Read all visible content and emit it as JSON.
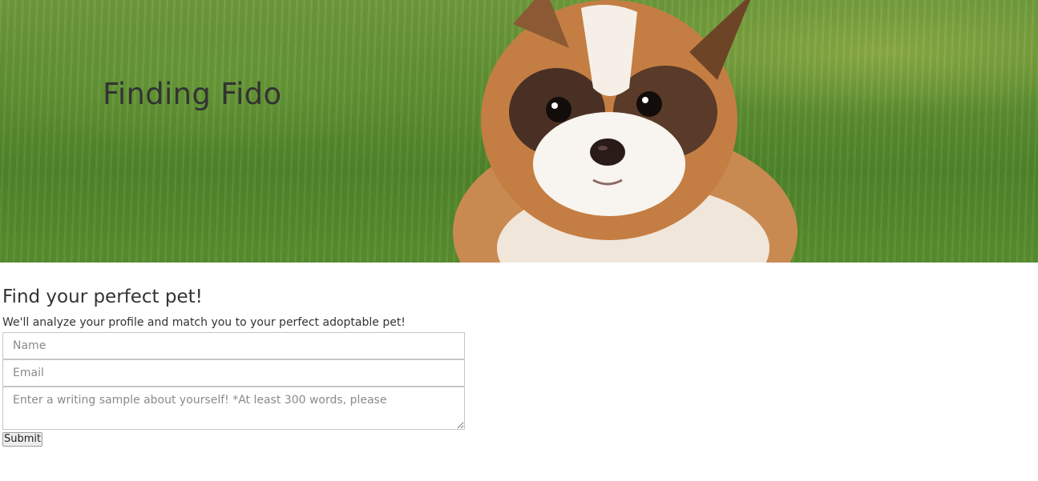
{
  "hero": {
    "title": "Finding Fido",
    "image": "puppy-on-grass"
  },
  "main": {
    "heading": "Find your perfect pet!",
    "description": "We'll analyze your profile and match you to your perfect adoptable pet!",
    "form": {
      "name_placeholder": "Name",
      "email_placeholder": "Email",
      "writing_placeholder": "Enter a writing sample about yourself! *At least 300 words, please",
      "submit_label": "Submit"
    }
  }
}
